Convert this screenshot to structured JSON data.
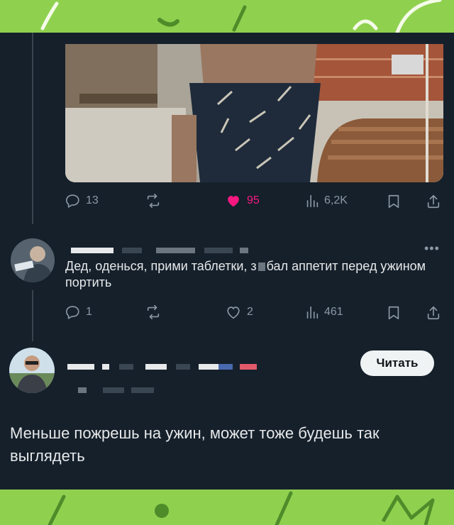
{
  "post": {
    "stats": {
      "replies": "13",
      "likes": "95",
      "views": "6,2K"
    }
  },
  "reply": {
    "text_before": "Дед, оденься, прими таблетки, з",
    "text_after": "бал аппетит перед ужином портить",
    "stats": {
      "replies": "1",
      "likes": "2",
      "views": "461"
    }
  },
  "next_post": {
    "follow_label": "Читать",
    "text": "Меньше пожрешь на ужин, может тоже будешь так выглядеть"
  },
  "colors": {
    "background": "#15202b",
    "text": "#e7e9ea",
    "muted": "#8b98a5",
    "like": "#f91880",
    "frame": "#8fd14f"
  }
}
